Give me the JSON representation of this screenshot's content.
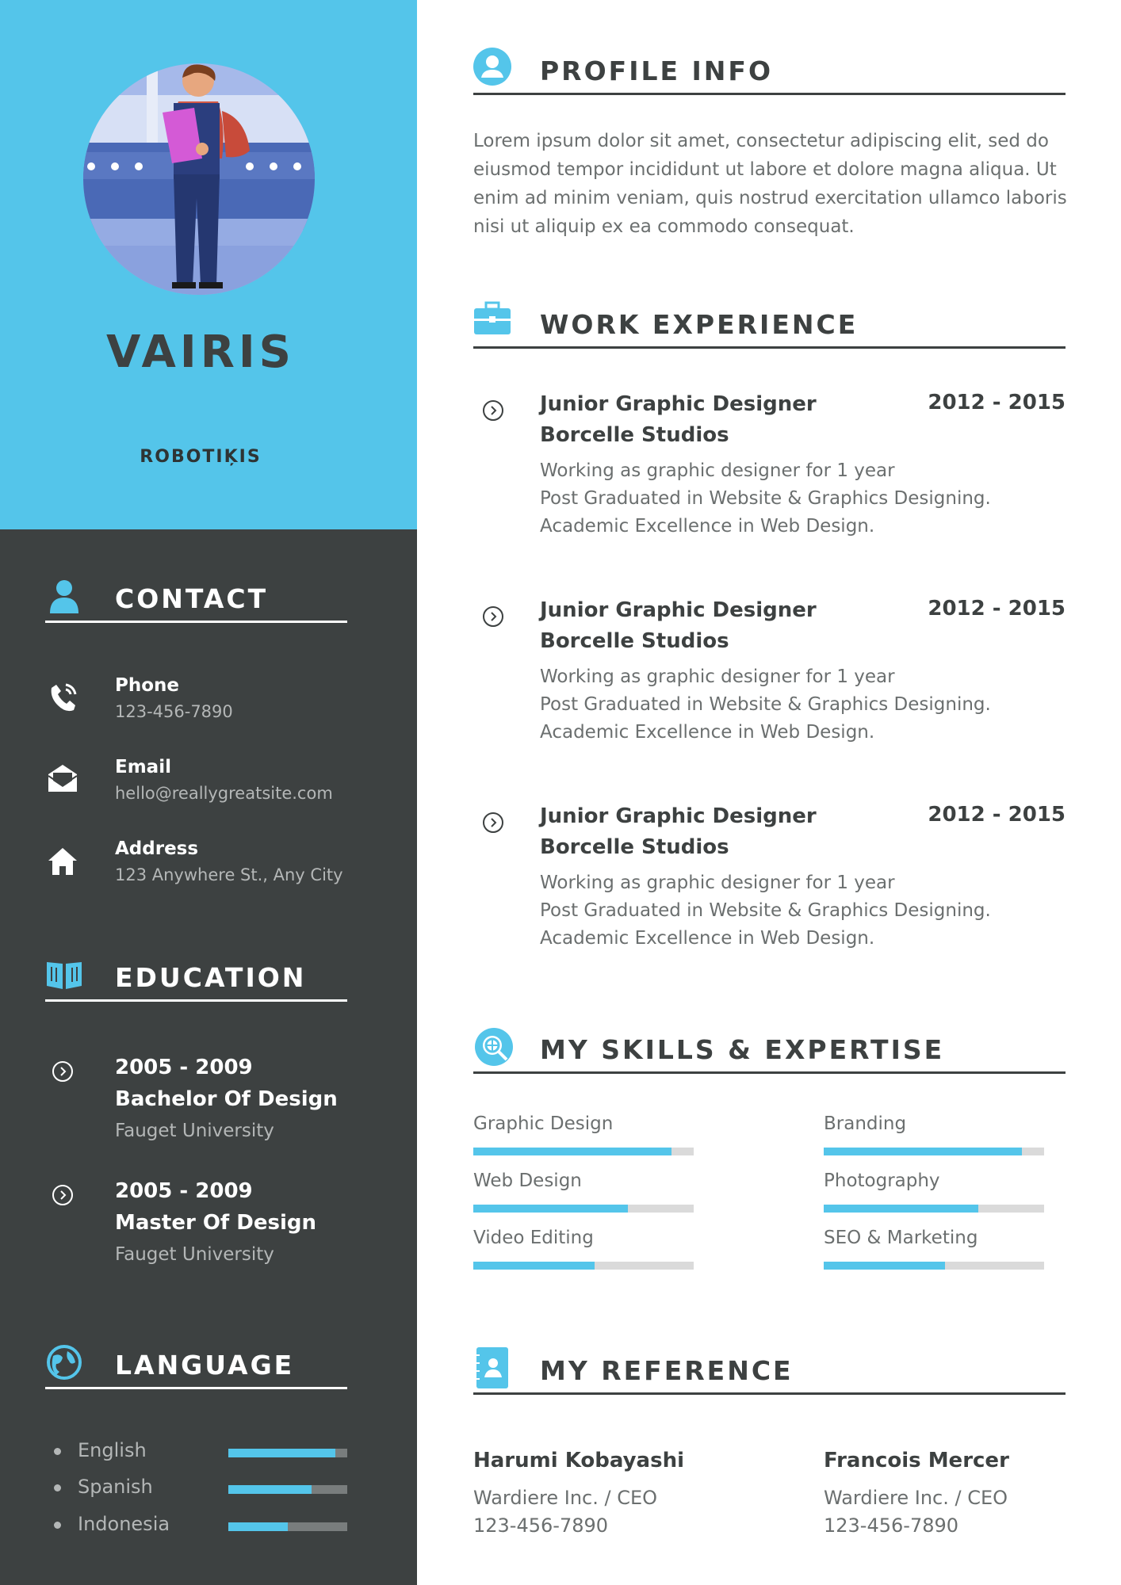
{
  "person": {
    "name": "VAIRIS",
    "title": "ROBOTIĶIS"
  },
  "sections": {
    "contact": "CONTACT",
    "education": "EDUCATION",
    "language": "LANGUAGE",
    "profile": "PROFILE INFO",
    "work": "WORK EXPERIENCE",
    "skills": "MY SKILLS & EXPERTISE",
    "reference": "MY REFERENCE"
  },
  "contact": [
    {
      "label": "Phone",
      "value": "123-456-7890",
      "icon": "phone-icon"
    },
    {
      "label": "Email",
      "value": "hello@reallygreatsite.com",
      "icon": "email-icon"
    },
    {
      "label": "Address",
      "value": "123 Anywhere St., Any City",
      "icon": "home-icon"
    }
  ],
  "education": [
    {
      "years": "2005 - 2009",
      "degree": "Bachelor Of Design",
      "school": "Fauget University"
    },
    {
      "years": "2005 - 2009",
      "degree": "Master Of Design",
      "school": "Fauget University"
    }
  ],
  "languages": [
    {
      "name": "English",
      "level": 0.9
    },
    {
      "name": "Spanish",
      "level": 0.7
    },
    {
      "name": "Indonesia",
      "level": 0.5
    }
  ],
  "profile": {
    "text": "Lorem ipsum dolor sit amet, consectetur adipiscing elit, sed do eiusmod tempor incididunt ut labore et dolore magna aliqua. Ut enim ad minim veniam, quis nostrud exercitation ullamco laboris nisi ut aliquip ex ea commodo consequat."
  },
  "work": [
    {
      "role": "Junior Graphic Designer",
      "company": "Borcelle Studios",
      "years": "2012 - 2015",
      "lines": [
        "Working as graphic designer for 1 year",
        "Post Graduated in Website & Graphics Designing.",
        "Academic Excellence in Web Design."
      ]
    },
    {
      "role": "Junior Graphic Designer",
      "company": "Borcelle Studios",
      "years": "2012 - 2015",
      "lines": [
        "Working as graphic designer for 1 year",
        "Post Graduated in Website & Graphics Designing.",
        "Academic Excellence in Web Design."
      ]
    },
    {
      "role": "Junior Graphic Designer",
      "company": "Borcelle Studios",
      "years": "2012 - 2015",
      "lines": [
        "Working as graphic designer for 1 year",
        "Post Graduated in Website & Graphics Designing.",
        "Academic Excellence in Web Design."
      ]
    }
  ],
  "skills": [
    {
      "name": "Graphic Design",
      "level": 0.9
    },
    {
      "name": "Branding",
      "level": 0.9
    },
    {
      "name": "Web Design",
      "level": 0.7
    },
    {
      "name": "Photography",
      "level": 0.7
    },
    {
      "name": "Video Editing",
      "level": 0.55
    },
    {
      "name": "SEO & Marketing",
      "level": 0.55
    }
  ],
  "references": [
    {
      "name": "Harumi Kobayashi",
      "company": "Wardiere Inc. / CEO",
      "phone": "123-456-7890"
    },
    {
      "name": "Francois Mercer",
      "company": "Wardiere Inc. / CEO",
      "phone": "123-456-7890"
    }
  ],
  "colors": {
    "accent": "#54c5ea",
    "dark": "#3d4141",
    "muted": "#6b6f6f"
  }
}
